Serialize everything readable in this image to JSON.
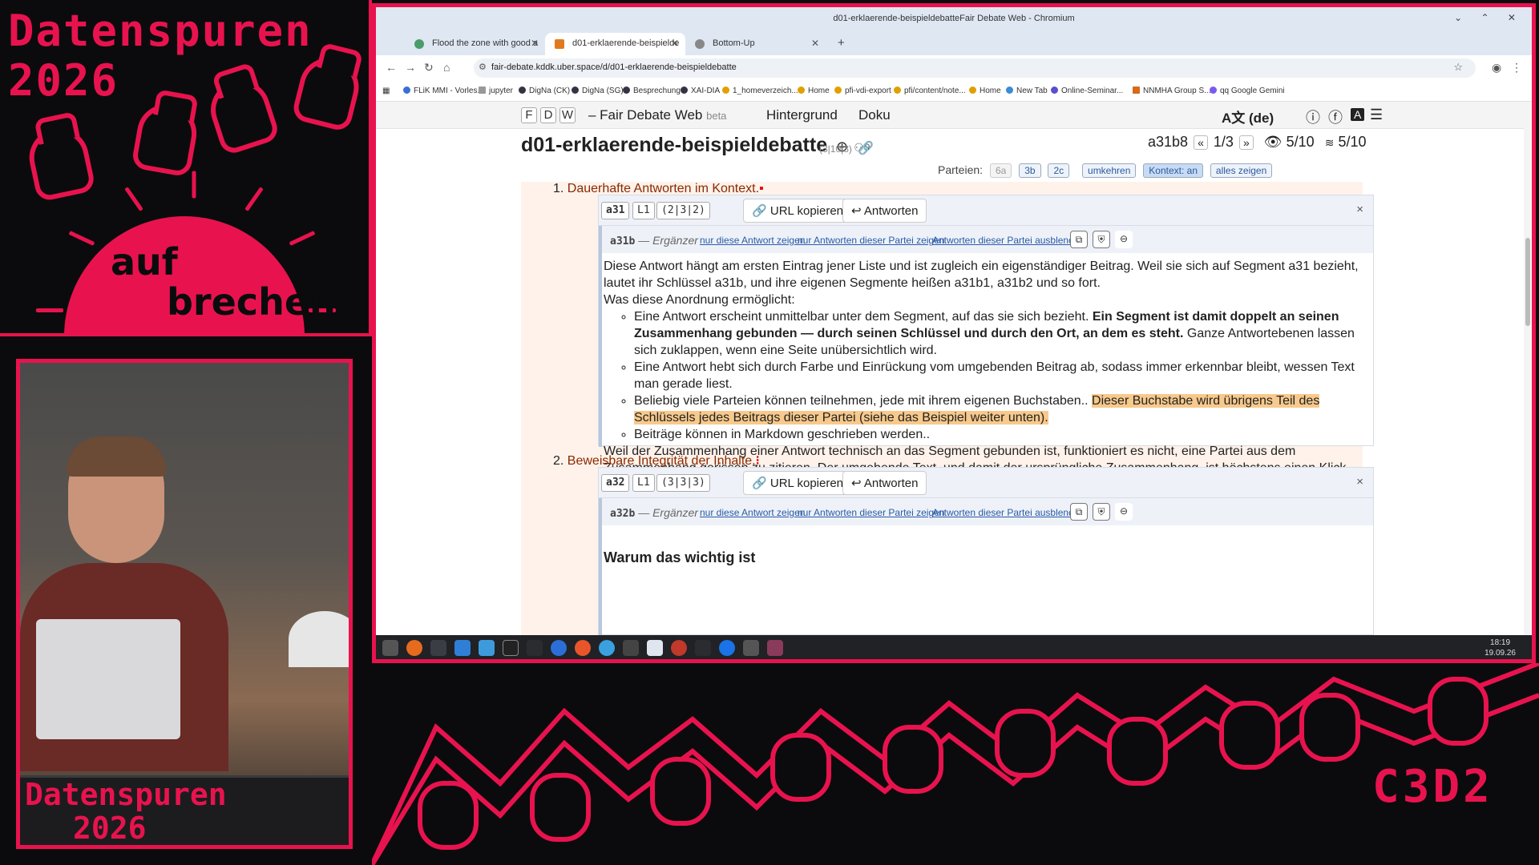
{
  "overlay": {
    "conf_title_line1": "Datenspuren",
    "conf_title_line2": "2026",
    "sun_word1": "auf",
    "sun_word2": "brechen",
    "podium_line1": "Datenspuren",
    "podium_line2": "2026",
    "org_logo": "C3D2",
    "accent_color": "#e8134e"
  },
  "browser": {
    "window_title": "d01-erklaerende-beispieldebatteFair Debate Web - Chromium",
    "tabs": [
      {
        "label": "Flood the zone with good a",
        "active": false
      },
      {
        "label": "d01-erklaerende-beispielde",
        "active": true
      },
      {
        "label": "Bottom-Up",
        "active": false
      }
    ],
    "new_tab": "+",
    "url": "fair-debate.kddk.uber.space/d/d01-erklaerende-beispieldebatte",
    "bookmarks": [
      "FLiK MMI - Vorles...",
      "jupyter",
      "DigNa (CK)",
      "DigNa (SG)",
      "Besprechung",
      "XAI-DIA",
      "1_homeverzeich...",
      "Home",
      "pfi-vdi-export",
      "pfi/content/note...",
      "Home",
      "New Tab",
      "Online-Seminar...",
      "NNMHA Group S...",
      "qq Google Gemini"
    ]
  },
  "app": {
    "nav_letters": [
      "F",
      "D",
      "W"
    ],
    "name": "– Fair Debate Web",
    "beta": "beta",
    "links": [
      "Hintergrund",
      "Doku"
    ],
    "lang": "A文 (de)",
    "doc_title": "d01-erklaerende-beispieldebatte",
    "doc_meta": "(3|10|3)",
    "key": "a31b8",
    "prev": "«",
    "page": "1/3",
    "next": "»",
    "views": "5/10",
    "likes": "5/10",
    "parteien_label": "Parteien:",
    "parties": [
      "6a",
      "3b",
      "2c"
    ],
    "party_buttons": [
      "umkehren",
      "Kontext: an",
      "alles zeigen"
    ]
  },
  "content": {
    "item1": {
      "num": "1.",
      "title": "Dauerhafte Antworten im Kontext."
    },
    "item2": {
      "num": "2.",
      "title": "Beweisbare Integrität der Inhalte."
    },
    "card1": {
      "seg": "a31",
      "level": "L1",
      "path": "(2|3|2)",
      "copy_url": "URL kopieren",
      "reply": "Antworten",
      "close": "×",
      "sub_key": "a31b",
      "sub_role": "— Ergänzer",
      "links": [
        "nur diese Antwort zeigen",
        "nur Antworten dieser Partei zeigen",
        "Antworten dieser Partei ausblenden"
      ],
      "p1": "Diese Antwort hängt am ersten Eintrag jener Liste und ist zugleich ein eigenständiger Beitrag.  Weil sie sich auf Segment a31 bezieht, lautet ihr Schlüssel a31b, und ihre eigenen Segmente heißen a31b1, a31b2 und so fort.",
      "p2": "Was diese Anordnung ermöglicht:",
      "li1_plain": "Eine Antwort erscheint unmittelbar unter dem Segment, auf das sie sich bezieht.",
      "li1_bold": "Ein Segment ist damit doppelt an seinen Zusammenhang gebunden — durch seinen Schlüssel und durch den Ort, an dem es steht.",
      "li1_tail": "Ganze Antwortebenen lassen sich zuklappen, wenn eine Seite unübersichtlich wird.",
      "li2": "Eine Antwort hebt sich durch Farbe und Einrückung vom umgebenden Beitrag ab, sodass immer erkennbar bleibt, wessen Text man gerade liest.",
      "li3_plain": "Beliebig viele Parteien können teilnehmen, jede mit ihrem eigenen Buchstaben..",
      "li3_hl": "Dieser Buchstabe wird übrigens Teil des Schlüssels jedes Beitrags dieser Partei (siehe das Beispiel weiter unten).",
      "li4": "Beiträge können in Markdown geschrieben werden..",
      "p3": "Weil der Zusammenhang einer Antwort technisch an das Segment gebunden ist, funktioniert es nicht, eine Partei aus dem Zusammenhang gerissen zu zitieren.  Der umgebende Text, und damit der ursprüngliche Zusammenhang, ist höchstens einen Klick entfernt."
    },
    "card2": {
      "seg": "a32",
      "level": "L1",
      "path": "(3|3|3)",
      "copy_url": "URL kopieren",
      "reply": "Antworten",
      "close": "×",
      "sub_key": "a32b",
      "sub_role": "— Ergänzer",
      "links": [
        "nur diese Antwort zeigen",
        "nur Antworten dieser Partei zeigen",
        "Antworten dieser Partei ausblenden"
      ],
      "heading": "Warum das wichtig ist"
    }
  },
  "taskbar": {
    "time": "18:19",
    "date": "19.09.26"
  }
}
